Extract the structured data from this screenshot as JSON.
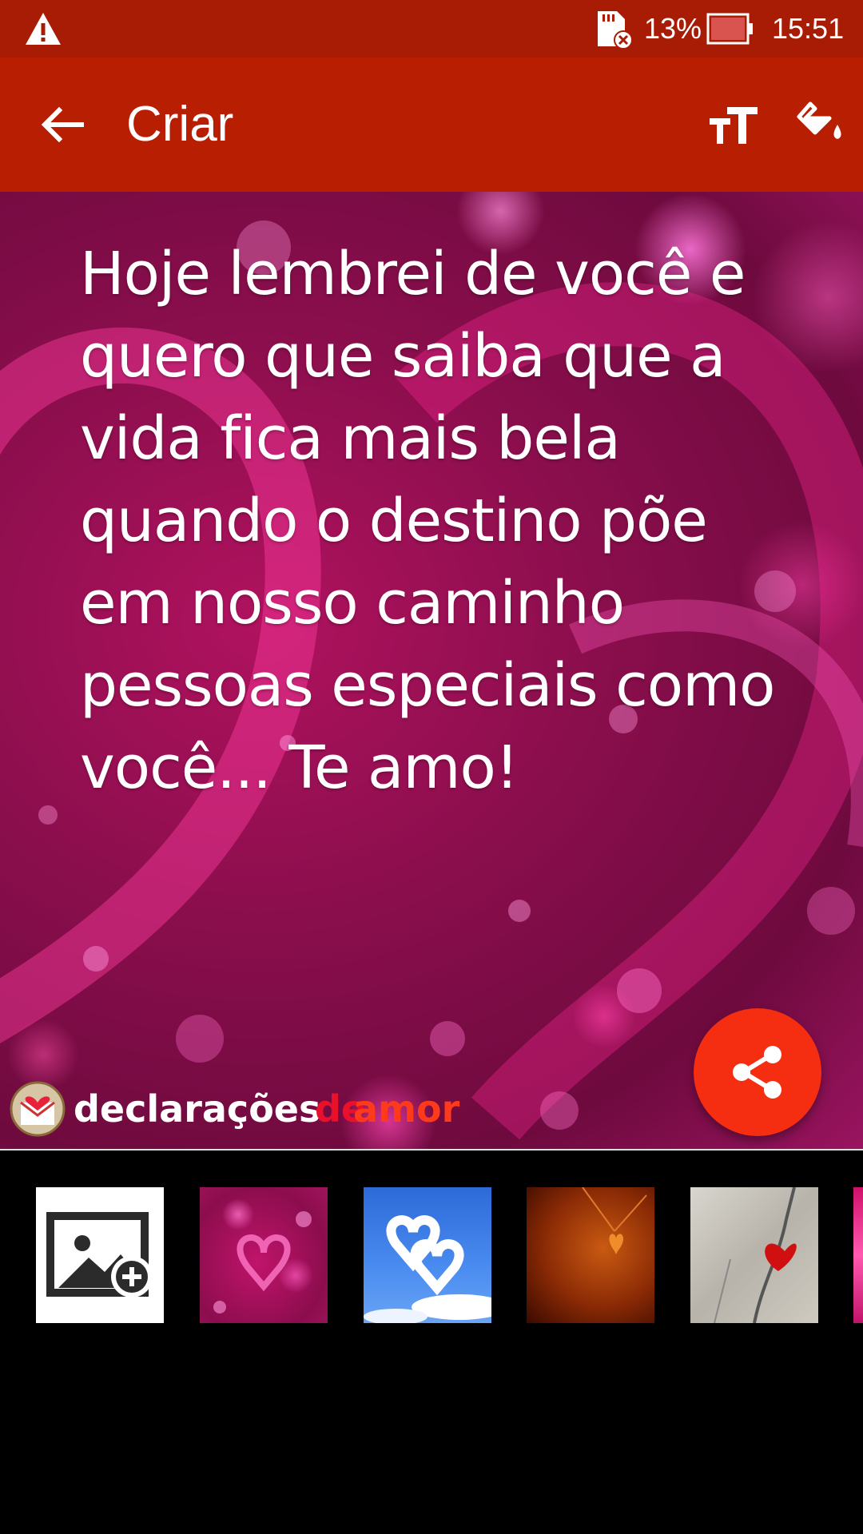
{
  "status_bar": {
    "battery_percent": "13%",
    "time": "15:51",
    "icons": [
      "warning-icon",
      "sd-card-error-icon",
      "battery-low-icon"
    ]
  },
  "app_bar": {
    "title": "Criar",
    "icons": [
      "back-arrow-icon",
      "text-size-icon",
      "paint-bucket-icon"
    ]
  },
  "card": {
    "quote": "Hoje lembrei de você e\nquero que saiba que a\nvida fica mais bela\nquando o destino põe\nem nosso caminho\npessoas especiais como\nvocê... Te amo!",
    "brand_part1": "declarações",
    "brand_part2": "de",
    "brand_part3": "amor",
    "share_icon": "share-icon"
  },
  "thumbnails": [
    {
      "name": "add-image",
      "icon": "add-photo-icon"
    },
    {
      "name": "pink-hearts-background"
    },
    {
      "name": "cloud-hearts-background"
    },
    {
      "name": "orange-heart-pendant-background"
    },
    {
      "name": "red-heart-wood-background"
    },
    {
      "name": "partial-pink-background"
    }
  ],
  "colors": {
    "status_bar": "#a81c06",
    "app_bar": "#b81e01",
    "fab": "#f52e12",
    "tray": "#000000"
  }
}
